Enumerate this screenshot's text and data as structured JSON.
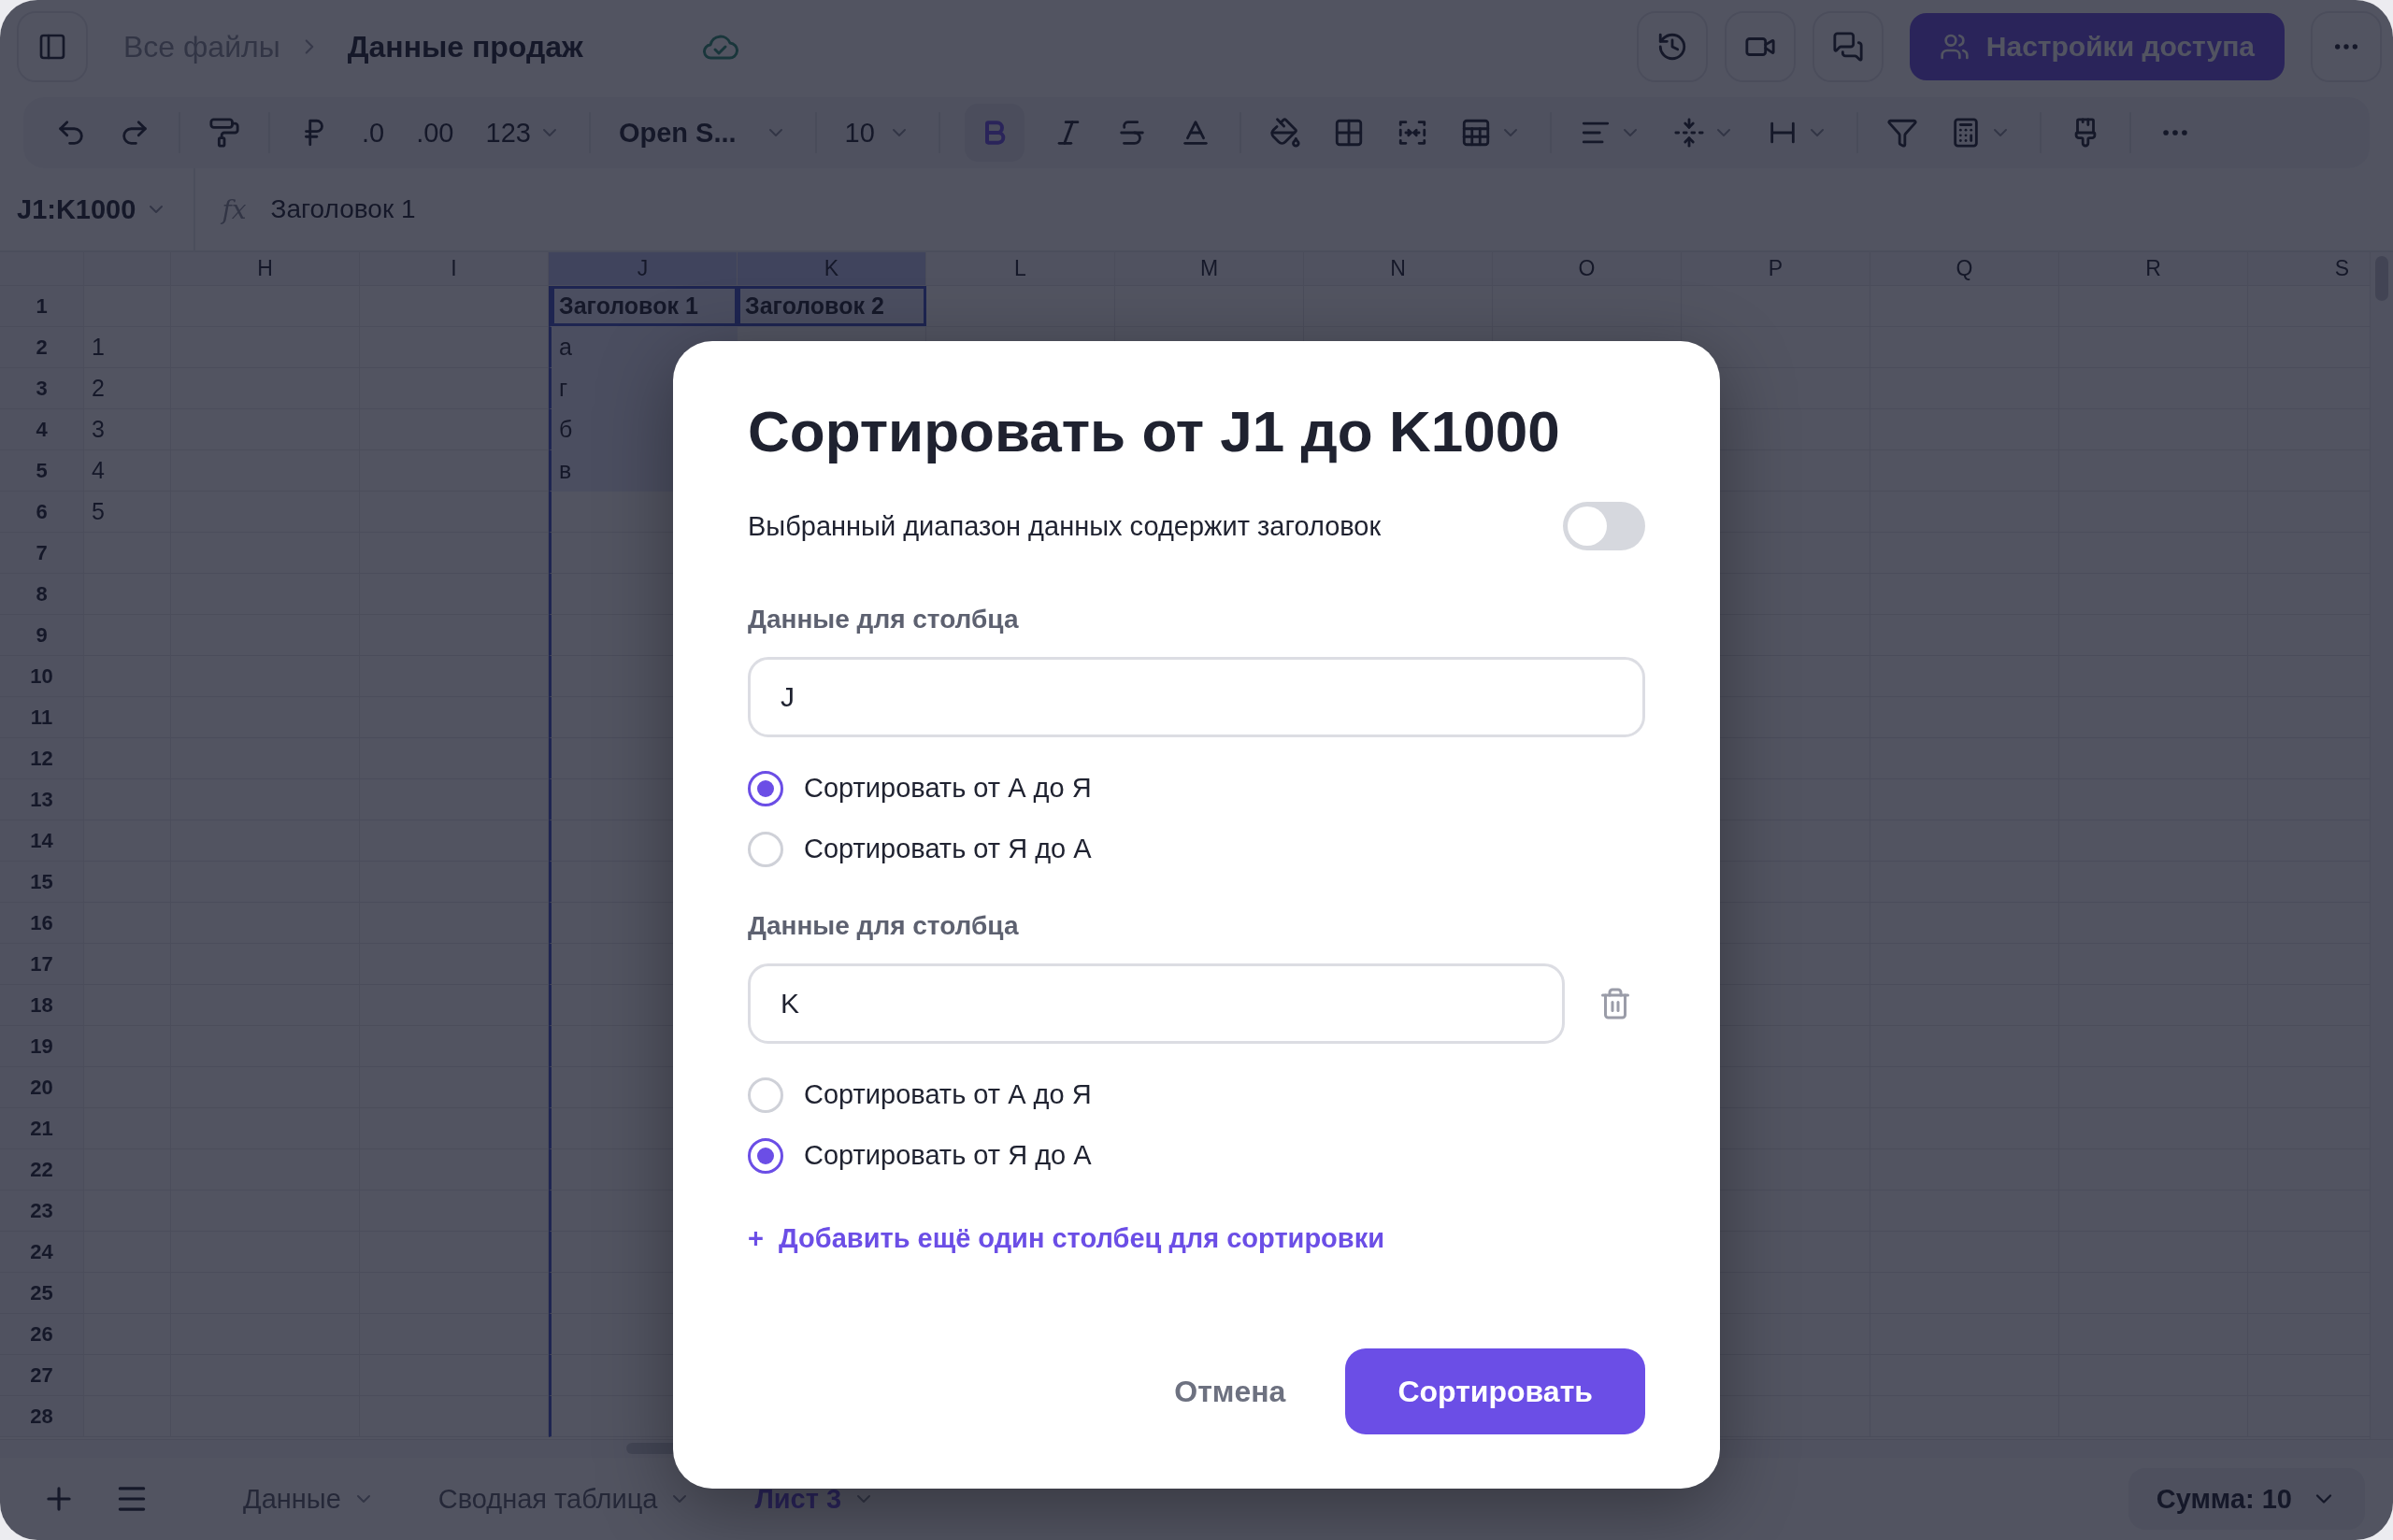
{
  "topbar": {
    "breadcrumb": [
      {
        "label": "Все файлы",
        "current": false
      },
      {
        "label": "Данные продаж",
        "current": true
      }
    ],
    "share_button": "Настройки доступа"
  },
  "toolbar": {
    "decimal_decrease": ".0",
    "decimal_increase": ".00",
    "number_format": "123",
    "font": "Open S...",
    "font_size": "10",
    "bold_active": true
  },
  "formula_bar": {
    "cell_ref": "J1:K1000",
    "fx": "fx",
    "formula": "Заголовок 1"
  },
  "grid": {
    "columns": [
      {
        "label": "H",
        "selected": false
      },
      {
        "label": "I",
        "selected": false
      },
      {
        "label": "J",
        "selected": true,
        "cells": [
          {
            "text": "Заголовок 1",
            "bold": true
          },
          {
            "text": "а",
            "bold": false
          },
          {
            "text": "г",
            "bold": false
          },
          {
            "text": "б",
            "bold": false
          },
          {
            "text": "в",
            "bold": false
          }
        ]
      },
      {
        "label": "K",
        "selected": true,
        "cells": [
          {
            "text": "Заголовок 2",
            "bold": true
          }
        ]
      },
      {
        "label": "L",
        "selected": false
      },
      {
        "label": "M",
        "selected": false
      },
      {
        "label": "N",
        "selected": false
      },
      {
        "label": "O",
        "selected": false
      },
      {
        "label": "P",
        "selected": false
      },
      {
        "label": "Q",
        "selected": false
      },
      {
        "label": "R",
        "selected": false
      },
      {
        "label": "S",
        "selected": false
      }
    ],
    "rows": [
      {
        "number": "1"
      },
      {
        "number": "2",
        "cut_cell": "1"
      },
      {
        "number": "3",
        "cut_cell": "2"
      },
      {
        "number": "4",
        "cut_cell": "3"
      },
      {
        "number": "5",
        "cut_cell": "4"
      },
      {
        "number": "6",
        "cut_cell": "5"
      },
      {
        "number": "7"
      },
      {
        "number": "8"
      },
      {
        "number": "9"
      },
      {
        "number": "10"
      },
      {
        "number": "11"
      },
      {
        "number": "12"
      },
      {
        "number": "13"
      },
      {
        "number": "14"
      },
      {
        "number": "15"
      },
      {
        "number": "16"
      },
      {
        "number": "17"
      },
      {
        "number": "18"
      },
      {
        "number": "19"
      },
      {
        "number": "20"
      },
      {
        "number": "21"
      },
      {
        "number": "22"
      },
      {
        "number": "23"
      },
      {
        "number": "24"
      },
      {
        "number": "25"
      },
      {
        "number": "26"
      },
      {
        "number": "27"
      },
      {
        "number": "28"
      }
    ]
  },
  "sheets": [
    {
      "label": "Данные",
      "selected": false
    },
    {
      "label": "Сводная таблица",
      "selected": false
    },
    {
      "label": "Лист 3",
      "selected": true
    }
  ],
  "summary": "Сумма: 10",
  "dialog": {
    "title": "Сортировать от J1 до K1000",
    "header_toggle": {
      "label": "Выбранный диапазон данных содержит заголовок",
      "on": false
    },
    "sort_columns": [
      {
        "label": "Данные для столбца",
        "value": "J",
        "removable": false,
        "options": [
          {
            "label": "Сортировать от А до Я",
            "selected": true
          },
          {
            "label": "Сортировать от Я до А",
            "selected": false
          }
        ]
      },
      {
        "label": "Данные для столбца",
        "value": "K",
        "removable": true,
        "options": [
          {
            "label": "Сортировать от А до Я",
            "selected": false
          },
          {
            "label": "Сортировать от Я до А",
            "selected": true
          }
        ]
      }
    ],
    "add_link": "+  Добавить ещё один столбец для сортировки",
    "cancel": "Отмена",
    "confirm": "Сортировать"
  }
}
